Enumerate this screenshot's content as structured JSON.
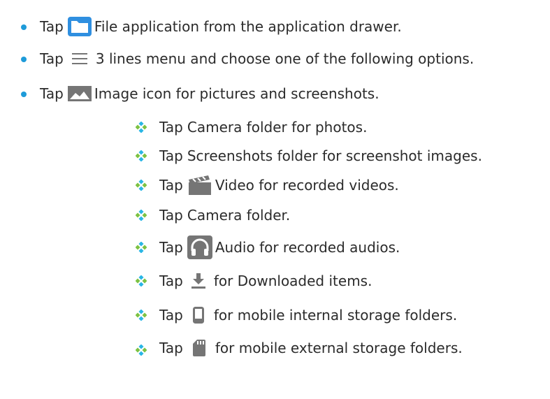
{
  "colors": {
    "text": "#2b2b2b",
    "bullet_blue": "#1e9bd9",
    "diamond_cyan": "#29b6e5",
    "diamond_green": "#7cc243",
    "folder_blue": "#2f8fe0",
    "icon_gray": "#757575"
  },
  "top_items": [
    {
      "prefix": "Tap",
      "icon": "folder-icon",
      "text": "File application from the application drawer."
    },
    {
      "prefix": "Tap",
      "icon": "menu-icon",
      "text": "3 lines menu and choose one of the following options."
    },
    {
      "prefix": "Tap",
      "icon": "image-icon",
      "text": "Image icon for pictures and screenshots."
    }
  ],
  "sub_items": [
    {
      "prefix": "Tap",
      "icon": "",
      "text": "Camera folder for photos."
    },
    {
      "prefix": "Tap",
      "icon": "",
      "text": "Screenshots folder for screenshot images."
    },
    {
      "prefix": "Tap",
      "icon": "video-icon",
      "text": "Video for recorded videos."
    },
    {
      "prefix": "Tap",
      "icon": "",
      "text": "Camera folder."
    },
    {
      "prefix": "Tap",
      "icon": "headphones-icon",
      "text": "Audio for recorded audios."
    },
    {
      "prefix": "Tap",
      "icon": "download-icon",
      "text": "for Downloaded items."
    },
    {
      "prefix": "Tap",
      "icon": "phone-icon",
      "text": "for mobile internal storage folders."
    },
    {
      "prefix": "Tap",
      "icon": "sd-card-icon",
      "text": "for mobile external storage folders."
    }
  ]
}
